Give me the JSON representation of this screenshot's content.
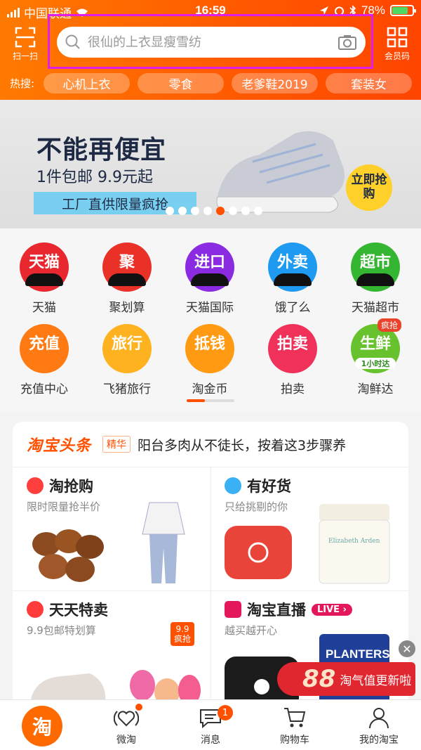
{
  "status_bar": {
    "carrier": "中国联通",
    "time": "16:59",
    "battery": "78%"
  },
  "header": {
    "scan_label": "扫一扫",
    "member_label": "会员码",
    "search_placeholder": "很仙的上衣显瘦雪纺",
    "hot_label": "热搜:",
    "hot_tags": [
      "心机上衣",
      "零食",
      "老爹鞋2019",
      "套装女"
    ]
  },
  "banner": {
    "title": "不能再便宜",
    "subtitle": "1件包邮 9.9元起",
    "strip": "工厂直供限量疯抢",
    "badge": "立即抢购",
    "dot_count": 8,
    "active_dot": 4
  },
  "grid": {
    "items": [
      {
        "icon_text": "天猫",
        "label": "天猫",
        "color": "#e8272f"
      },
      {
        "icon_text": "聚",
        "label": "聚划算",
        "color": "#ea3128"
      },
      {
        "icon_text": "进口",
        "label": "天猫国际",
        "color": "#8a2be2"
      },
      {
        "icon_text": "外卖",
        "label": "饿了么",
        "color": "#1e9bf0"
      },
      {
        "icon_text": "超市",
        "label": "天猫超市",
        "color": "#35b633"
      },
      {
        "icon_text": "充值",
        "label": "充值中心",
        "color": "#ff7a13"
      },
      {
        "icon_text": "旅行",
        "label": "飞猪旅行",
        "color": "#ffb21f"
      },
      {
        "icon_text": "抵钱",
        "label": "淘金币",
        "color": "#ff9a12"
      },
      {
        "icon_text": "拍卖",
        "label": "拍卖",
        "color": "#f0325a"
      },
      {
        "icon_text": "生鲜",
        "label": "淘鲜达",
        "color": "#67c22d",
        "tag": "疯抢",
        "subtag": "1小时达"
      }
    ]
  },
  "headline": {
    "logo": "淘宝头条",
    "tag": "精华",
    "text": "阳台多肉从不徒长，按着这3步骤养"
  },
  "tiles": [
    {
      "title": "淘抢购",
      "subtitle": "限时限量抢半价",
      "icon_color": "#ff3e3e"
    },
    {
      "title": "有好货",
      "subtitle": "只给挑剔的你",
      "icon_color": "#3ab1f5"
    },
    {
      "title": "天天特卖",
      "subtitle": "9.9包邮特划算",
      "icon_color": "#ff3b3b",
      "price_tag": "9.9 疯抢"
    },
    {
      "title": "淘宝直播",
      "subtitle": "越买越开心",
      "icon_color": "#e5175b",
      "live_tag": "LIVE ›"
    }
  ],
  "float_badge": {
    "number": "88",
    "text": "淘气值更新啦"
  },
  "tabbar": {
    "home_icon_text": "淘",
    "items": [
      "微淘",
      "消息",
      "购物车",
      "我的淘宝"
    ],
    "message_count": "1"
  },
  "colors": {
    "brand": "#ff5000",
    "highlight_border": "#e11ee8"
  }
}
